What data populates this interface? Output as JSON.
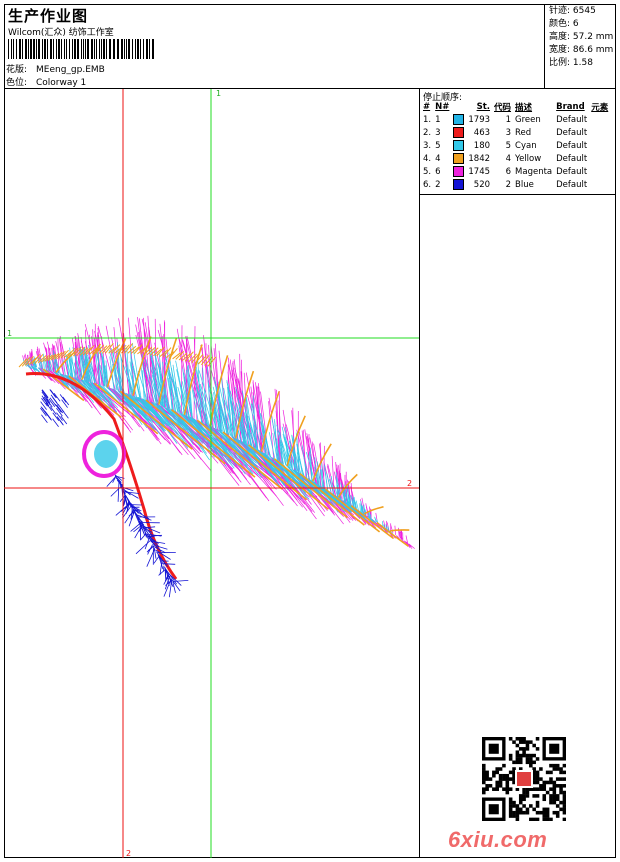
{
  "header": {
    "title": "生产作业图",
    "company": "Wilcom(汇众) 纺饰工作室",
    "design_label": "花版:",
    "design_value": "MEeng_gp.EMB",
    "colorway_label": "色位:",
    "colorway_value": "Colorway 1"
  },
  "stats": {
    "stitches": "针迹: 6545",
    "colors": "颜色: 6",
    "height": "高度: 57.2 mm",
    "width": "宽度: 86.6 mm",
    "scale": "比例: 1.58"
  },
  "canvas": {
    "vline_green": "1",
    "hline_green": "1",
    "hline_red": "2",
    "vline_red": "2"
  },
  "stop_sequence": {
    "title": "停止顺序:",
    "columns": [
      "#",
      "N#",
      "St.",
      "代码",
      "描述",
      "Brand",
      "元素"
    ],
    "rows": [
      {
        "idx": "1.",
        "n": "1",
        "color": "#22b4e6",
        "st": "1793",
        "code": "1",
        "desc": "Green",
        "brand": "Default"
      },
      {
        "idx": "2.",
        "n": "3",
        "color": "#ee1c1c",
        "st": "463",
        "code": "3",
        "desc": "Red",
        "brand": "Default"
      },
      {
        "idx": "3.",
        "n": "5",
        "color": "#33c8e8",
        "st": "180",
        "code": "5",
        "desc": "Cyan",
        "brand": "Default"
      },
      {
        "idx": "4.",
        "n": "4",
        "color": "#f0a01e",
        "st": "1842",
        "code": "4",
        "desc": "Yellow",
        "brand": "Default"
      },
      {
        "idx": "5.",
        "n": "6",
        "color": "#ee22dd",
        "st": "1745",
        "code": "6",
        "desc": "Magenta",
        "brand": "Default"
      },
      {
        "idx": "6.",
        "n": "2",
        "color": "#1414d4",
        "st": "520",
        "code": "2",
        "desc": "Blue",
        "brand": "Default"
      }
    ]
  },
  "watermark": {
    "text": "6xiu.com"
  },
  "colors": {
    "grid_green": "#22dd22",
    "grid_red": "#ee1111",
    "magenta": "#ee22dd",
    "cyan": "#33c8e8",
    "orange": "#f0a01e",
    "red": "#ee1c1c",
    "blue": "#1414d4"
  },
  "icons": {
    "qr": "qr-code-icon",
    "barcode": "barcode-icon"
  }
}
